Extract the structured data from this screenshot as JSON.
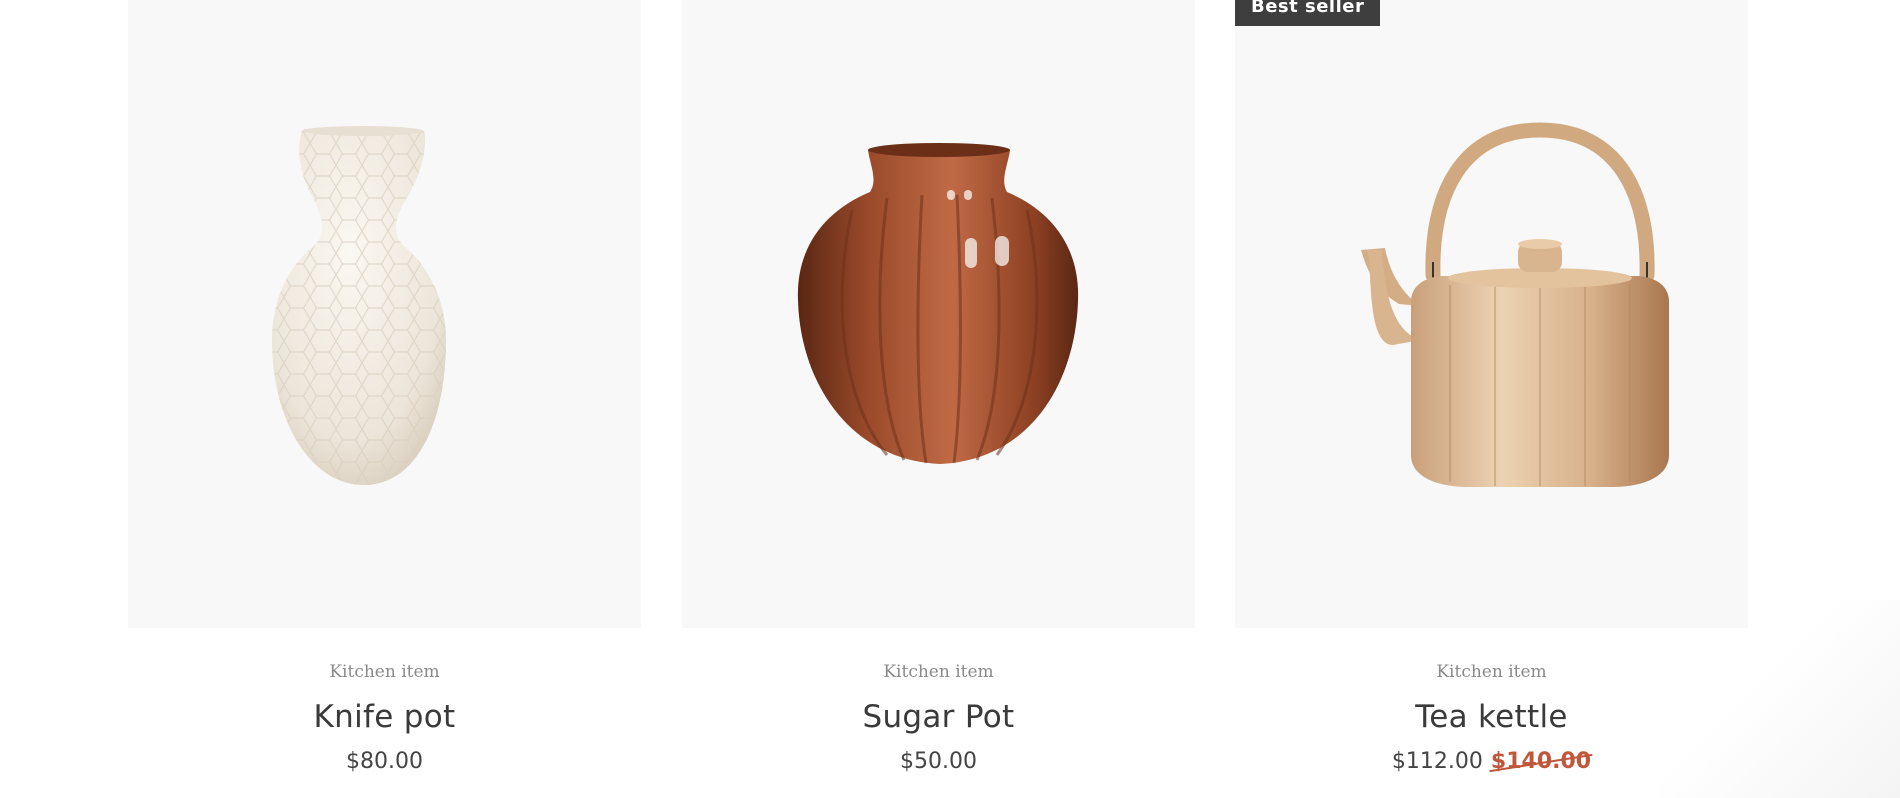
{
  "products": [
    {
      "badge": "",
      "category": "Kitchen item",
      "title": "Knife pot",
      "price": "$80.00",
      "old_price": "",
      "image_icon": "white-honeycomb-vase-image"
    },
    {
      "badge": "",
      "category": "Kitchen item",
      "title": "Sugar Pot",
      "price": "$50.00",
      "old_price": "",
      "image_icon": "terracotta-fluted-pot-image"
    },
    {
      "badge": "Best seller",
      "category": "Kitchen item",
      "title": "Tea kettle",
      "price": "$112.00",
      "old_price": "$140.00",
      "image_icon": "wooden-tea-kettle-image"
    }
  ],
  "colors": {
    "card_background": "#f8f8f8",
    "badge_background": "#3e3e3e",
    "sale_price": "#c0563a",
    "text": "#3a3a3a"
  }
}
